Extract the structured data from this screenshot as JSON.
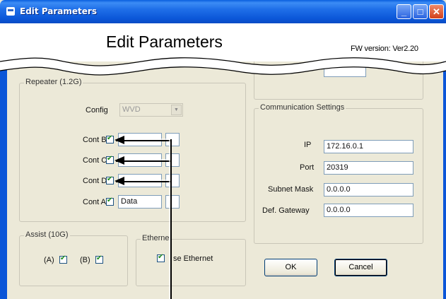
{
  "window": {
    "title": "Edit Parameters",
    "minimize": "_",
    "maximize": "□",
    "close": "✕"
  },
  "header": {
    "title": "Edit Parameters",
    "fw_version": "FW version: Ver2.20"
  },
  "repeater": {
    "group_label": "Repeater (1.2G)",
    "config_label": "Config",
    "config_value": "WVD",
    "rows": [
      {
        "label": "Cont B",
        "value": "",
        "small": ""
      },
      {
        "label": "Cont C",
        "value": "",
        "small": ""
      },
      {
        "label": "Cont D",
        "value": "",
        "small": ""
      },
      {
        "label": "Cont A",
        "value": "Data",
        "small": ""
      }
    ]
  },
  "top_partial_field": {
    "value": ""
  },
  "assist": {
    "group_label": "Assist (10G)",
    "a_label": "(A)",
    "b_label": "(B)"
  },
  "ethernet": {
    "group_label": "Etherne",
    "checkbox_label": "se Ethernet"
  },
  "comm": {
    "group_label": "Communication Settings",
    "ip_label": "IP",
    "ip_value": "172.16.0.1",
    "port_label": "Port",
    "port_value": "20319",
    "subnet_label": "Subnet Mask",
    "subnet_value": "0.0.0.0",
    "gateway_label": "Def. Gateway",
    "gateway_value": "0.0.0.0"
  },
  "buttons": {
    "ok": "OK",
    "cancel": "Cancel"
  },
  "colors": {
    "titlebar": "#0b56d8",
    "dialog_bg": "#ece9d8",
    "field_border": "#7f9db9"
  }
}
